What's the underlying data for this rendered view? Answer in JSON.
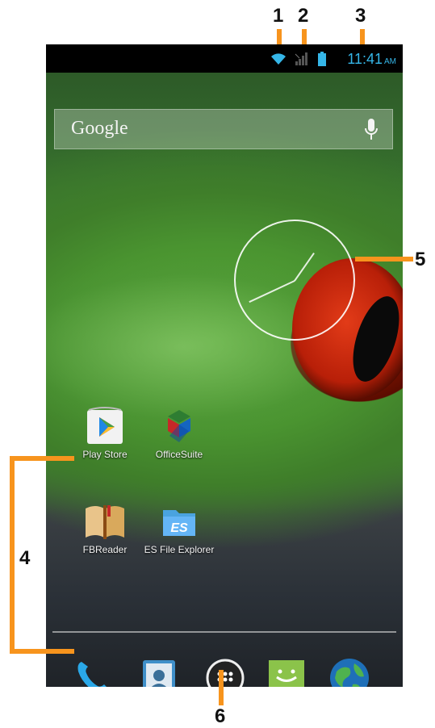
{
  "status_bar": {
    "time": "11:41",
    "ampm": "AM"
  },
  "search": {
    "label": "Google"
  },
  "apps": {
    "play_store": "Play Store",
    "officesuite": "OfficeSuite",
    "fbreader": "FBReader",
    "es_file": "ES File Explorer"
  },
  "callouts": {
    "c1": "1",
    "c2": "2",
    "c3": "3",
    "c4": "4",
    "c5": "5",
    "c6": "6"
  },
  "colors": {
    "callout_orange": "#f7941d",
    "status_blue": "#35b6e8"
  }
}
